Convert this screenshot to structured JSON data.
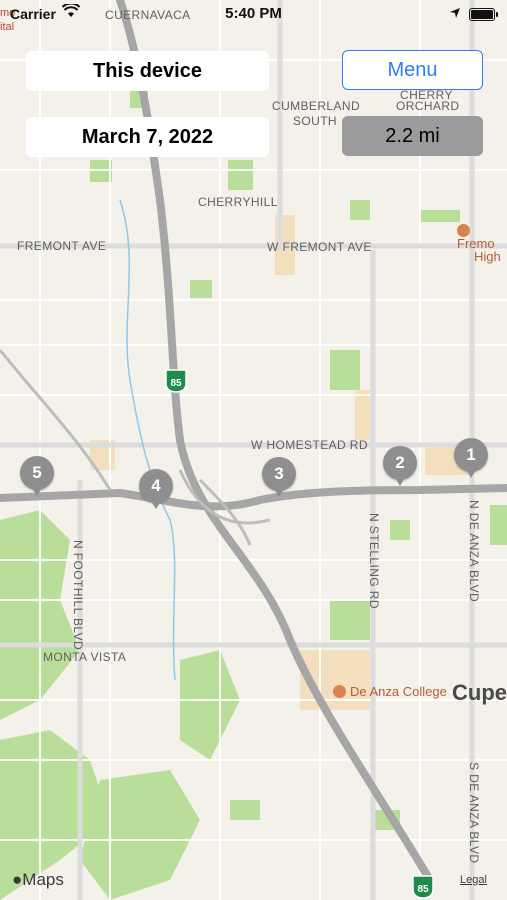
{
  "status_bar": {
    "carrier": "Carrier",
    "time": "5:40 PM"
  },
  "controls": {
    "device_label": "This device",
    "date_label": "March 7, 2022",
    "menu_label": "Menu",
    "distance_label": "2.2 mi"
  },
  "pins": [
    {
      "label": "1"
    },
    {
      "label": "2"
    },
    {
      "label": "3"
    },
    {
      "label": "4"
    },
    {
      "label": "5"
    }
  ],
  "map_labels": {
    "cuernavaca": "CUERNAVACA",
    "cumberland": "CUMBERLAND",
    "south": "SOUTH",
    "cherry": "CHERRY",
    "orchard": "ORCHARD",
    "cherryhill": "CHERRYHILL",
    "fremont_ave": "FREMONT AVE",
    "w_fremont_ave": "W FREMONT AVE",
    "fremont_high_1": "Fremo",
    "fremont_high_2": "High",
    "homestead": "W HOMESTEAD RD",
    "foothill": "N FOOTHILL BLVD",
    "stelling": "N STELLING RD",
    "de_anza_n": "N DE ANZA BLVD",
    "de_anza_s": "S DE ANZA BLVD",
    "monta_vista": "MONTA VISTA",
    "de_anza_college": "De Anza College",
    "cupertino": "Cupe",
    "hwy_85": "85",
    "edge_top_left_1": "mo",
    "edge_top_left_2": "ital"
  },
  "footer": {
    "maps_logo": "Maps",
    "legal": "Legal"
  },
  "colors": {
    "accent": "#2f7df6",
    "pin": "#8e8e8e",
    "highway": "#a6a6a6",
    "park": "#a7d987",
    "land": "#f4f1ea"
  }
}
